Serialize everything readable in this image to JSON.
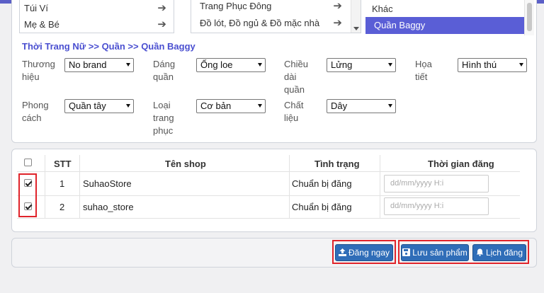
{
  "categories": {
    "col1": [
      "Túi Ví",
      "Mẹ & Bé"
    ],
    "col2": [
      "Trang Phục Đông",
      "Đồ lót, Đồ ngủ & Đồ mặc nhà"
    ],
    "col3": [
      "Khác",
      "Quần Baggy"
    ]
  },
  "breadcrumb": "Thời Trang Nữ >> Quần >> Quần Baggy",
  "attributes": [
    {
      "label": "Thương hiệu",
      "value": "No brand"
    },
    {
      "label": "Dáng quần",
      "value": "Ống loe"
    },
    {
      "label": "Chiều dài quần",
      "value": "Lửng"
    },
    {
      "label": "Họa tiết",
      "value": "Hình thú"
    },
    {
      "label": "Phong cách",
      "value": "Quần tây"
    },
    {
      "label": "Loại trang phục",
      "value": "Cơ bản"
    },
    {
      "label": "Chất liệu",
      "value": "Dây"
    }
  ],
  "table": {
    "headers": {
      "stt": "STT",
      "shop": "Tên shop",
      "status": "Tình trạng",
      "time": "Thời gian đăng"
    },
    "rows": [
      {
        "checked": true,
        "stt": "1",
        "shop": "SuhaoStore",
        "status": "Chuẩn bị đăng",
        "time_placeholder": "dd/mm/yyyy H:i"
      },
      {
        "checked": true,
        "stt": "2",
        "shop": "suhao_store",
        "status": "Chuẩn bị đăng",
        "time_placeholder": "dd/mm/yyyy H:i"
      }
    ]
  },
  "buttons": {
    "post_now": "Đăng ngay",
    "save_product": "Lưu sản phẩm",
    "schedule": "Lịch đăng"
  },
  "colors": {
    "accent": "#5a5ed6",
    "button": "#2f6db8",
    "highlight": "#e0242b"
  }
}
